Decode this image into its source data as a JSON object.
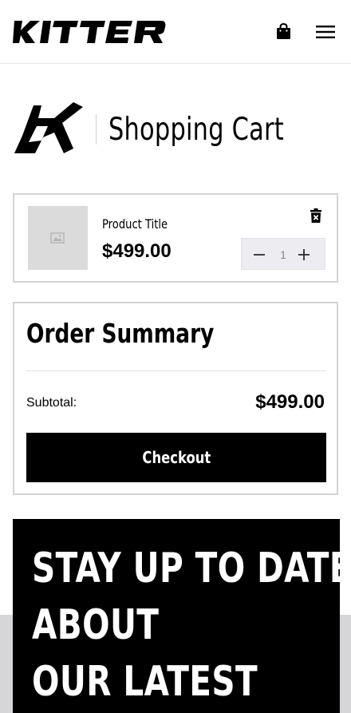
{
  "header": {
    "logo_text": "KITTER",
    "icons": [
      "shopping-bag-icon",
      "hamburger-menu-icon"
    ]
  },
  "page": {
    "title": "Shopping Cart",
    "brand_mark": "kitter-brand-mark"
  },
  "cart": {
    "items": [
      {
        "title": "Product Title",
        "price": "$499.00",
        "quantity": "1",
        "image_icon": "image-placeholder-icon",
        "remove_icon": "trash-icon"
      }
    ]
  },
  "summary": {
    "title": "Order Summary",
    "subtotal_label": "Subtotal:",
    "subtotal_value": "$499.00",
    "checkout_label": "Checkout"
  },
  "newsletter": {
    "lines": [
      "STAY UP TO DATE",
      "ABOUT",
      "OUR LATEST"
    ]
  },
  "colors": {
    "primary": "#000000",
    "background": "#ffffff",
    "border": "#d4d4d4",
    "stepper_bg": "#ececf1",
    "footer_bg": "#d6d6d9"
  }
}
